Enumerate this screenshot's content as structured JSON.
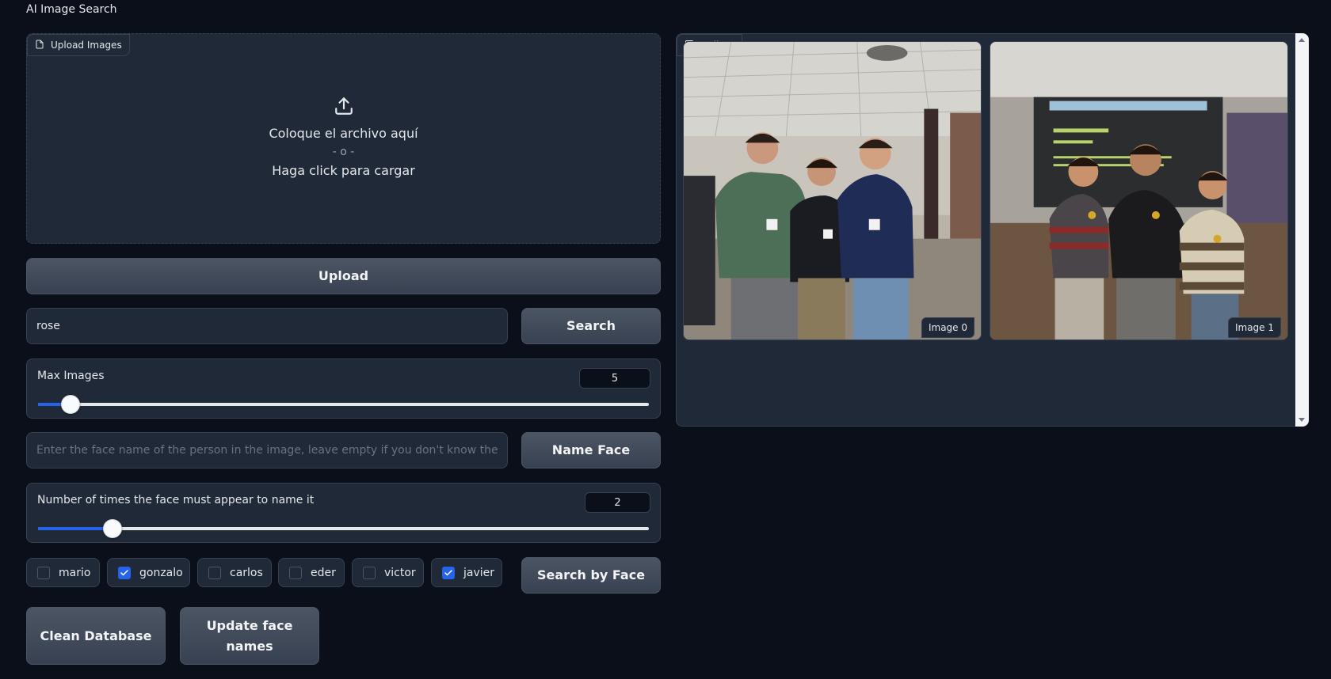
{
  "app": {
    "title": "AI Image Search"
  },
  "upload": {
    "label": "Upload Images",
    "drop_text": "Coloque el archivo aquí",
    "or_text": "- o -",
    "click_text": "Haga click para cargar",
    "button_label": "Upload"
  },
  "search": {
    "value": "rose",
    "placeholder": "",
    "button_label": "Search"
  },
  "max_images": {
    "label": "Max Images",
    "value": "5",
    "fraction": 0.053
  },
  "name_face": {
    "placeholder": "Enter the face name of the person in the image, leave empty if you don't know the person",
    "value": "",
    "button_label": "Name Face"
  },
  "face_threshold": {
    "label": "Number of times the face must appear to name it",
    "value": "2",
    "fraction": 0.122
  },
  "faces": [
    {
      "name": "mario",
      "checked": false
    },
    {
      "name": "gonzalo",
      "checked": true
    },
    {
      "name": "carlos",
      "checked": false
    },
    {
      "name": "eder",
      "checked": false
    },
    {
      "name": "victor",
      "checked": false
    },
    {
      "name": "javier",
      "checked": true
    }
  ],
  "face_search_button": "Search by Face",
  "clean_button": "Clean Database",
  "update_button": "Update face names",
  "gallery": {
    "label": "Gallery",
    "items": [
      {
        "caption": "Image 0"
      },
      {
        "caption": "Image 1"
      }
    ]
  },
  "colors": {
    "background": "#0b0f19",
    "panel": "#1f2937",
    "border": "#374151",
    "accent": "#2563eb"
  }
}
